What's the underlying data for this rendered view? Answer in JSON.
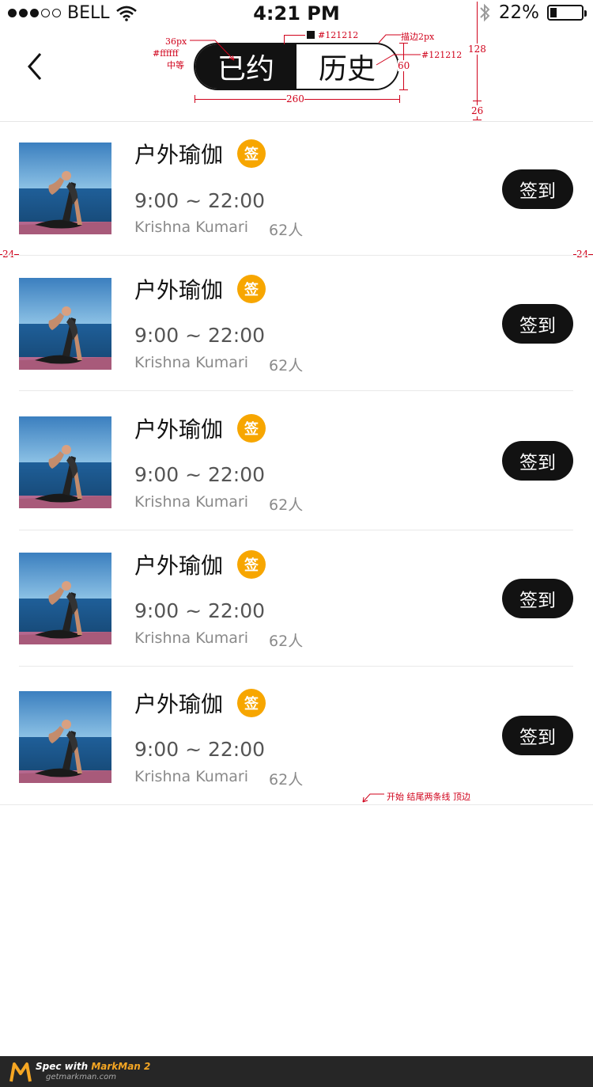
{
  "status_bar": {
    "carrier": "BELL",
    "time": "4:21 PM",
    "battery_percent": "22%",
    "battery_level": 0.22
  },
  "header": {
    "tabs": [
      {
        "label": "已约",
        "active": true
      },
      {
        "label": "历史",
        "active": false
      }
    ]
  },
  "annotations": {
    "font_size": "36px",
    "text_color": "#ffffff",
    "font_weight": "中等",
    "bg_color": "#121212",
    "stroke": "描边2px",
    "stroke_color": "#121212",
    "height": "60",
    "width": "260",
    "header_height": "128",
    "top_gap": "26",
    "margin_left": "24",
    "margin_right": "24",
    "divider_note": "开始 结尾两条线 顶边"
  },
  "items": [
    {
      "title": "户外瑜伽",
      "badge": "签",
      "time": "9:00 ~ 22:00",
      "instructor": "Krishna Kumari",
      "count": "62人",
      "button": "签到"
    },
    {
      "title": "户外瑜伽",
      "badge": "签",
      "time": "9:00 ~ 22:00",
      "instructor": "Krishna Kumari",
      "count": "62人",
      "button": "签到"
    },
    {
      "title": "户外瑜伽",
      "badge": "签",
      "time": "9:00 ~ 22:00",
      "instructor": "Krishna Kumari",
      "count": "62人",
      "button": "签到"
    },
    {
      "title": "户外瑜伽",
      "badge": "签",
      "time": "9:00 ~ 22:00",
      "instructor": "Krishna Kumari",
      "count": "62人",
      "button": "签到"
    },
    {
      "title": "户外瑜伽",
      "badge": "签",
      "time": "9:00 ~ 22:00",
      "instructor": "Krishna Kumari",
      "count": "62人",
      "button": "签到"
    }
  ],
  "footer": {
    "brand_prefix": "Spec with ",
    "brand_name": "MarkMan 2",
    "brand_url": "getmarkman.com"
  }
}
